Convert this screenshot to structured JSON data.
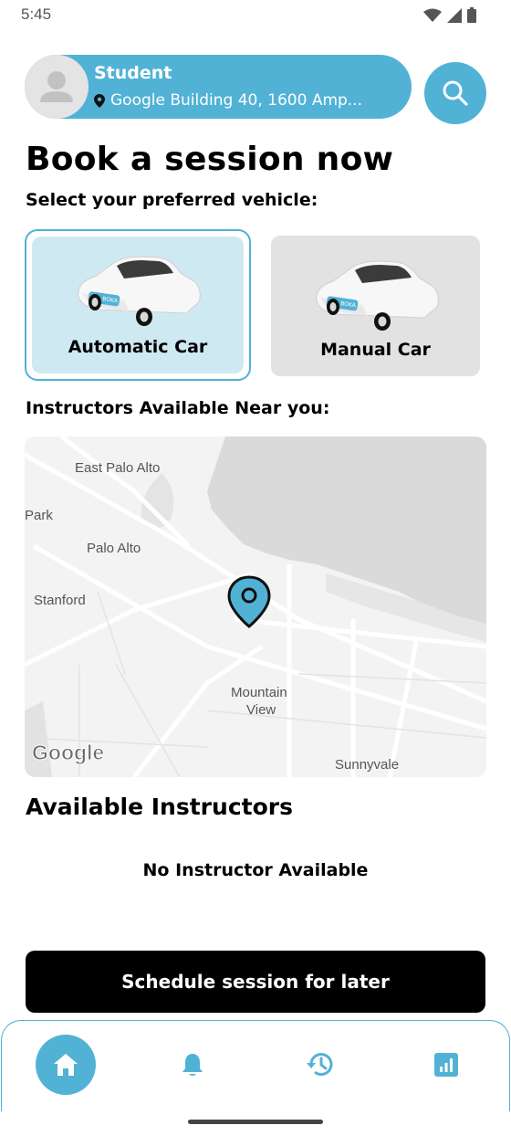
{
  "status_bar": {
    "time": "5:45"
  },
  "profile": {
    "name": "Student",
    "location": "Google Building 40, 1600 Amp..."
  },
  "page_title": "Book a session now",
  "vehicle_prompt": "Select your preferred vehicle:",
  "vehicles": [
    {
      "label": "Automatic Car",
      "selected": true
    },
    {
      "label": "Manual Car",
      "selected": false
    }
  ],
  "instructors_near_label": "Instructors Available Near you:",
  "map": {
    "places": [
      "East Palo Alto",
      "Park",
      "Palo Alto",
      "Stanford",
      "Mountain",
      "View",
      "Sunnyvale"
    ],
    "attribution": "Google"
  },
  "available_heading": "Available Instructors",
  "no_instructor_text": "No Instructor Available",
  "schedule_button": "Schedule session for later",
  "car_badge": "BOKA",
  "colors": {
    "accent": "#51b2d6",
    "selected_bg": "#cfe9f2",
    "unselected_bg": "#e2e2e2"
  },
  "nav": {
    "items": [
      {
        "icon": "home-icon",
        "active": true
      },
      {
        "icon": "bell-icon",
        "active": false
      },
      {
        "icon": "history-icon",
        "active": false
      },
      {
        "icon": "chart-icon",
        "active": false
      }
    ]
  }
}
